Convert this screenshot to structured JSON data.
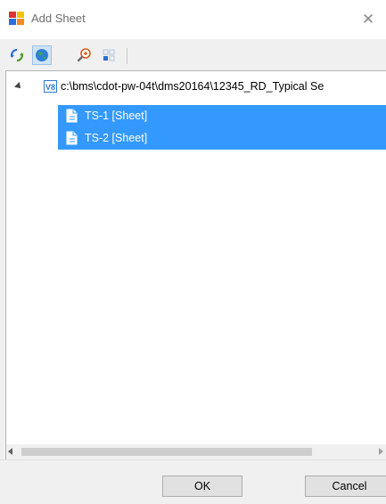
{
  "window": {
    "title": "Add Sheet",
    "close_glyph": "✕"
  },
  "toolbar": {
    "buttons": [
      {
        "icon": "refresh-icon"
      },
      {
        "icon": "globe-icon"
      },
      {
        "icon": "zoom-icon"
      },
      {
        "icon": "grid-icon"
      }
    ]
  },
  "tree": {
    "root": {
      "badge": "V8",
      "label": "c:\\bms\\cdot-pw-04t\\dms20164\\12345_RD_Typical Se"
    },
    "items": [
      {
        "label": "TS-1 [Sheet]",
        "selected": true
      },
      {
        "label": "TS-2 [Sheet]",
        "selected": true
      }
    ]
  },
  "footer": {
    "ok_label": "OK",
    "cancel_label": "Cancel"
  },
  "colors": {
    "selection": "#3399ff",
    "accent": "#2d7bd1"
  }
}
